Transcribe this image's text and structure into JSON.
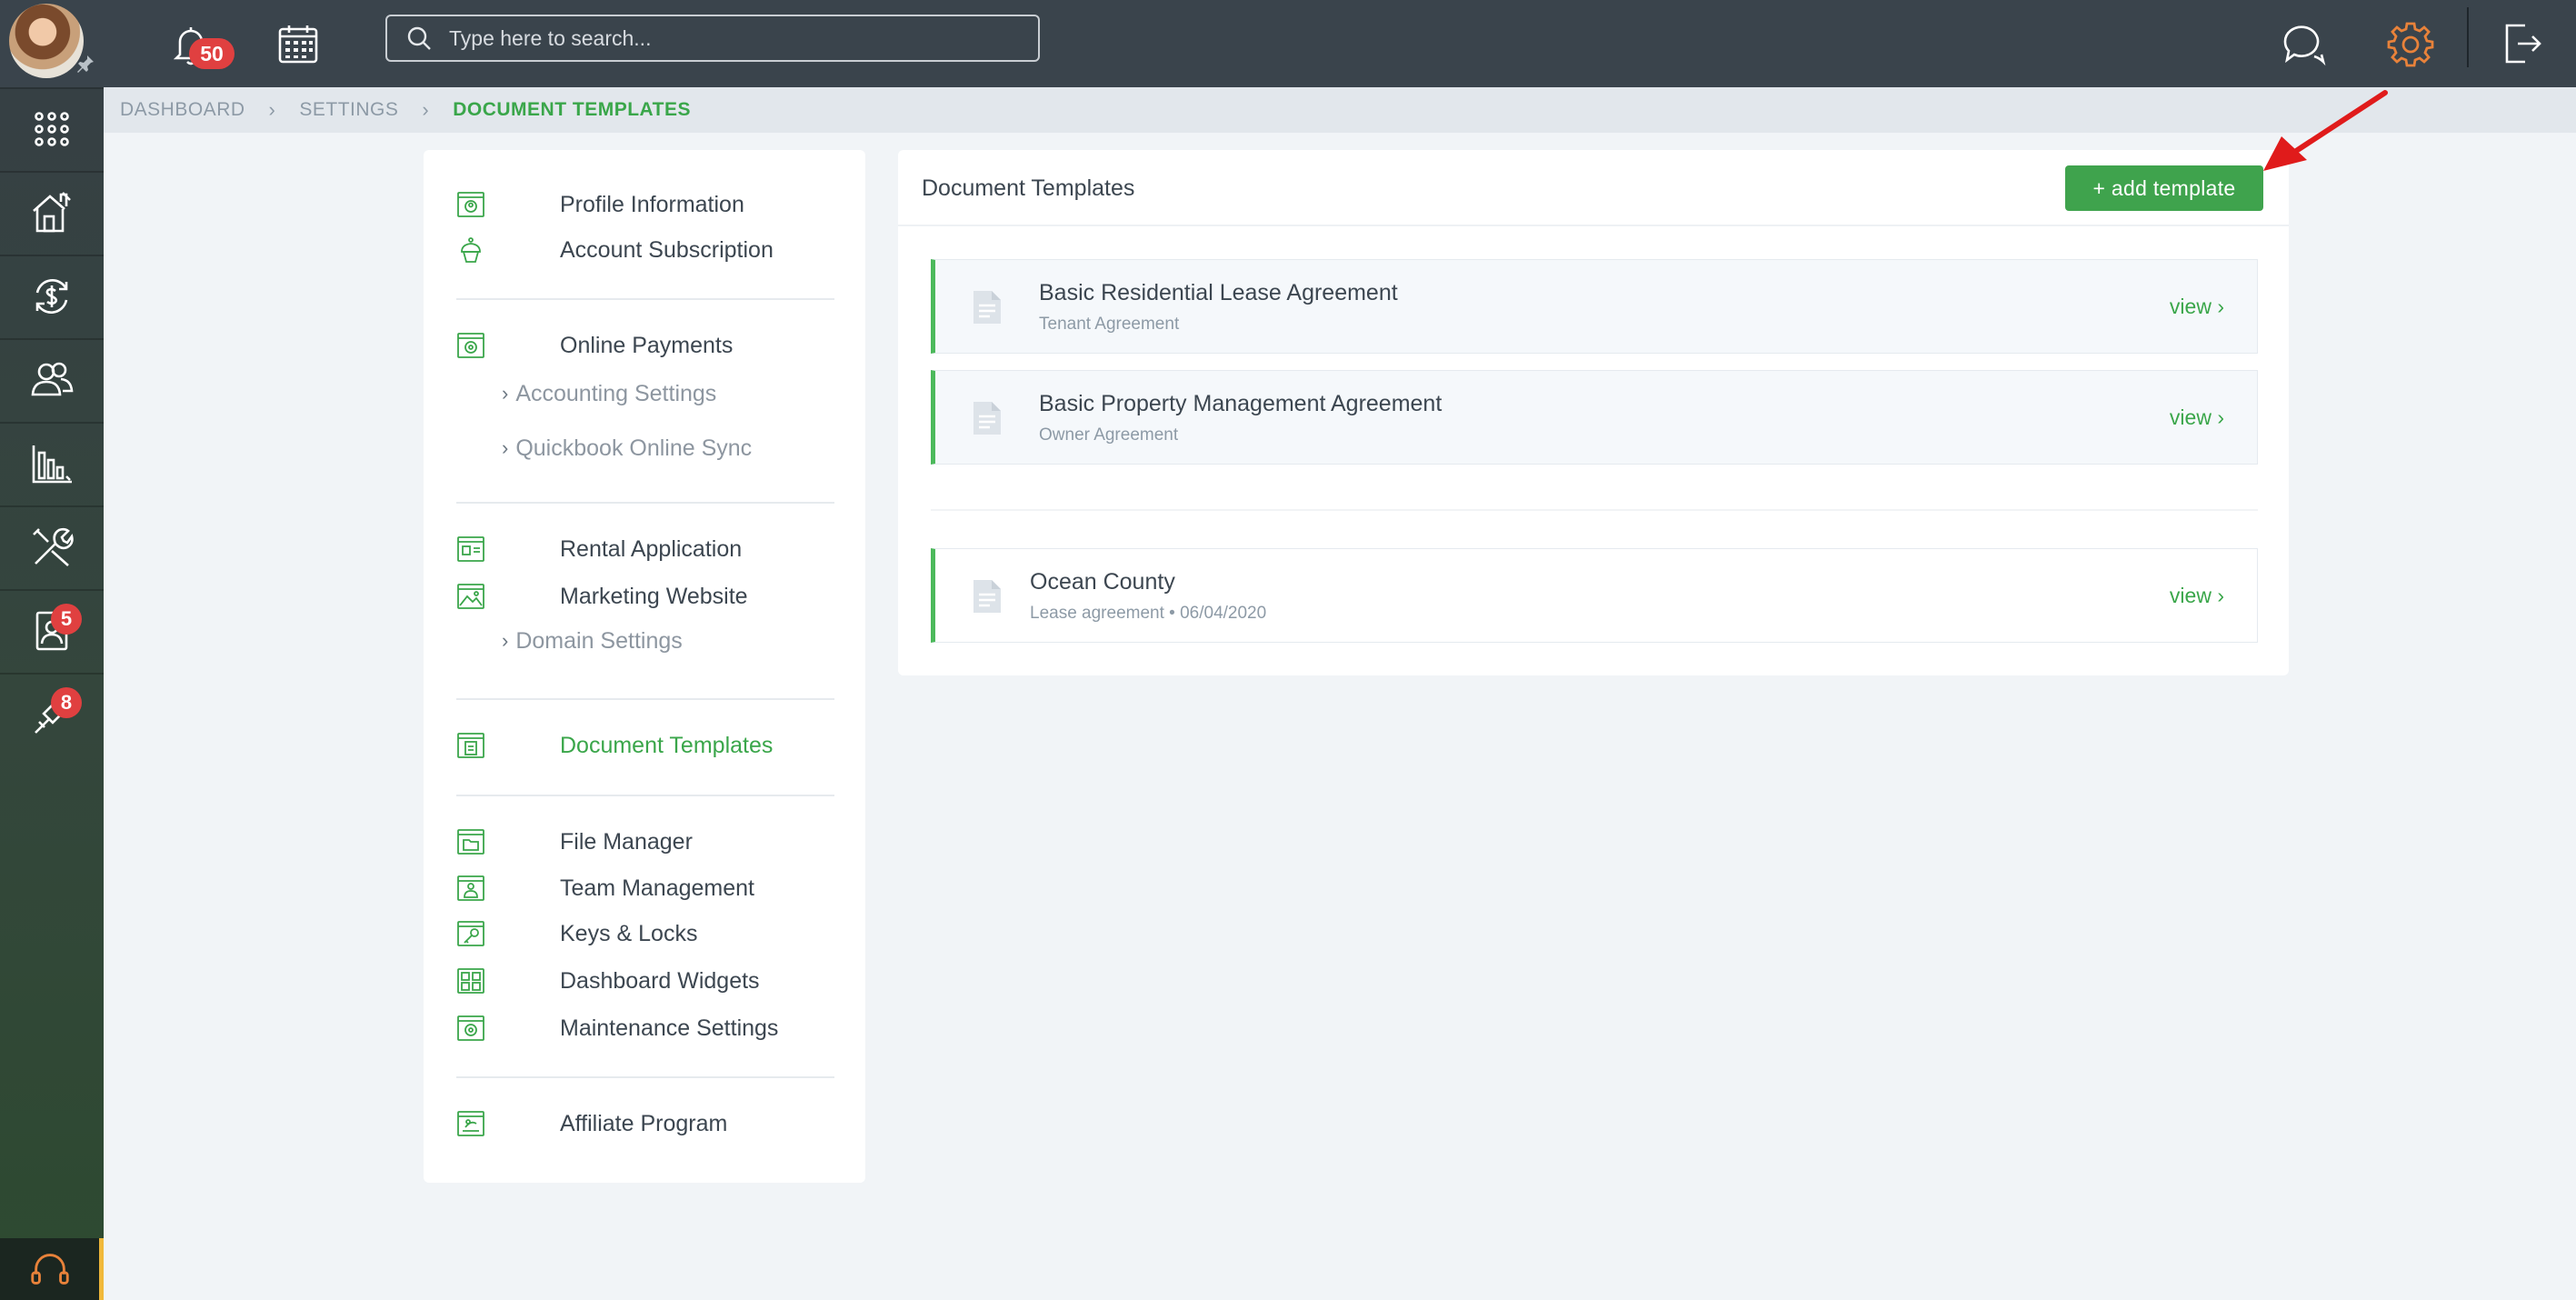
{
  "topbar": {
    "notifications_count": "50",
    "search_placeholder": "Type here to search..."
  },
  "rail": {
    "badges": {
      "applications": "5",
      "maintenance": "8"
    }
  },
  "breadcrumb": {
    "items": [
      "DASHBOARD",
      "SETTINGS",
      "DOCUMENT TEMPLATES"
    ]
  },
  "settings_menu": {
    "profile_information": "Profile Information",
    "account_subscription": "Account Subscription",
    "online_payments": "Online Payments",
    "accounting_settings": "Accounting Settings",
    "quickbook_online_sync": "Quickbook Online Sync",
    "rental_application": "Rental Application",
    "marketing_website": "Marketing Website",
    "domain_settings": "Domain Settings",
    "document_templates": "Document Templates",
    "file_manager": "File Manager",
    "team_management": "Team Management",
    "keys_locks": "Keys & Locks",
    "dashboard_widgets": "Dashboard Widgets",
    "maintenance_settings": "Maintenance Settings",
    "affiliate_program": "Affiliate Program"
  },
  "panel": {
    "title": "Document Templates",
    "add_button": "+ add template",
    "templates": [
      {
        "name": "Basic Residential Lease Agreement",
        "subtitle": "Tenant Agreement",
        "view": "view"
      },
      {
        "name": "Basic Property Management Agreement",
        "subtitle": "Owner Agreement",
        "view": "view"
      }
    ],
    "custom_templates": [
      {
        "name": "Ocean County",
        "subtitle": "Lease agreement • 06/04/2020",
        "view": "view"
      }
    ]
  },
  "colors": {
    "accent_green": "#3fa34d",
    "badge_red": "#e04040",
    "topbar_bg": "#3a444c",
    "settings_icon_orange": "#e8823a",
    "annotation_arrow": "#e01b1b"
  },
  "icons": [
    "avatar",
    "pin-icon",
    "apps-grid-icon",
    "properties-icon",
    "payments-icon",
    "people-icon",
    "reports-icon",
    "tools-icon",
    "applications-icon",
    "maintenance-icon",
    "support-icon",
    "bell-icon",
    "calendar-icon",
    "search-icon",
    "chat-icon",
    "gear-icon",
    "logout-icon",
    "document-icon"
  ]
}
